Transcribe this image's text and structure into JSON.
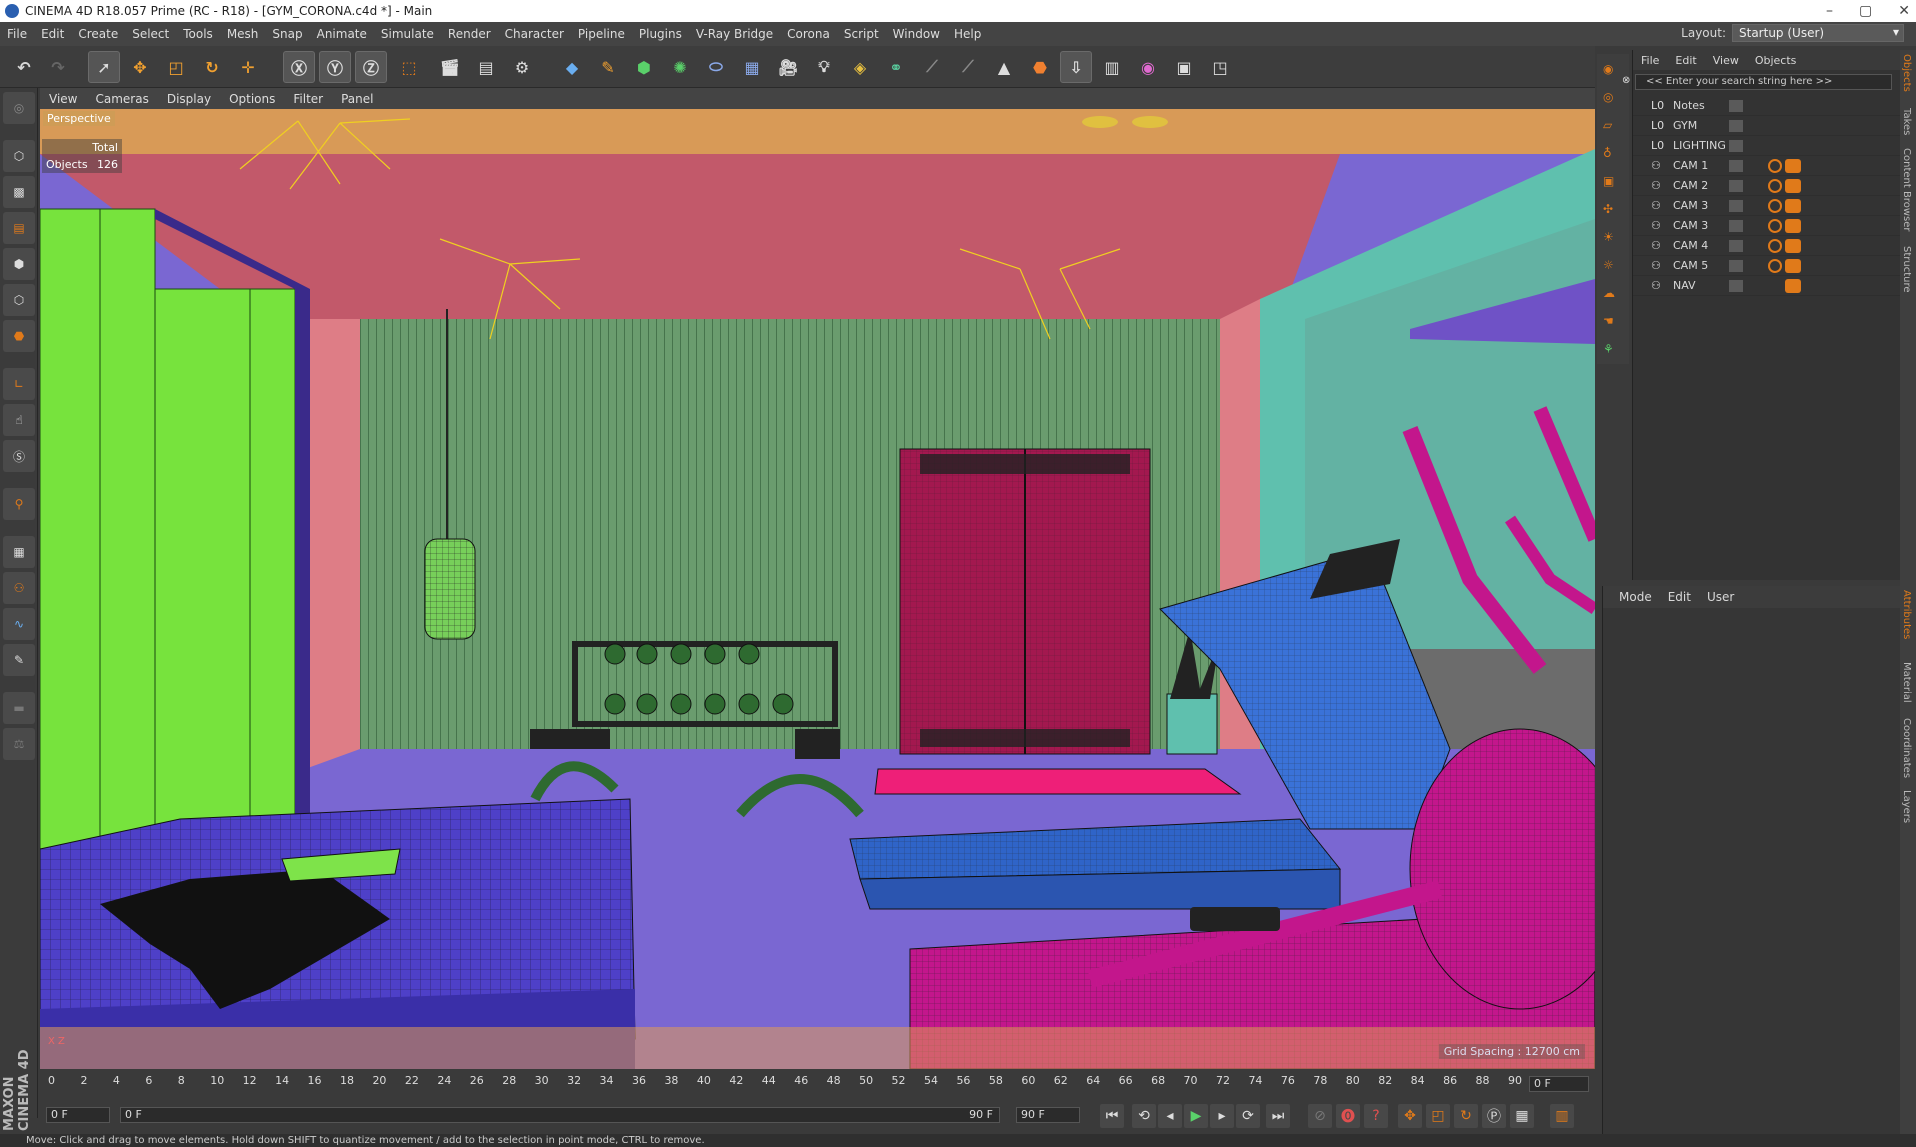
{
  "window": {
    "title": "CINEMA 4D R18.057 Prime (RC - R18) - [GYM_CORONA.c4d *] - Main",
    "controls": [
      "–",
      "▢",
      "✕"
    ]
  },
  "menu": [
    "File",
    "Edit",
    "Create",
    "Select",
    "Tools",
    "Mesh",
    "Snap",
    "Animate",
    "Simulate",
    "Render",
    "Character",
    "Pipeline",
    "Plugins",
    "V-Ray Bridge",
    "Corona",
    "Script",
    "Window",
    "Help"
  ],
  "layout": {
    "label": "Layout:",
    "value": "Startup (User)"
  },
  "viewport": {
    "menu": [
      "View",
      "Cameras",
      "Display",
      "Options",
      "Filter",
      "Panel"
    ],
    "mode": "Perspective",
    "stats": {
      "total_label": "Total",
      "objects_label": "Objects",
      "objects_value": "126"
    },
    "grid_spacing": "Grid Spacing : 12700 cm",
    "axis": "X  Z"
  },
  "object_manager": {
    "menu": [
      "File",
      "Edit",
      "View",
      "Objects"
    ],
    "search_placeholder": "<< Enter your search string here >>",
    "objects": [
      {
        "name": "Notes",
        "type": "layer",
        "tags": false
      },
      {
        "name": "GYM",
        "type": "layer",
        "tags": false
      },
      {
        "name": "LIGHTING",
        "type": "layer",
        "tags": false
      },
      {
        "name": "CAM 1",
        "type": "camera",
        "tags": true
      },
      {
        "name": "CAM 2",
        "type": "camera",
        "tags": true
      },
      {
        "name": "CAM 3",
        "type": "camera",
        "tags": true
      },
      {
        "name": "CAM 3",
        "type": "camera",
        "tags": true
      },
      {
        "name": "CAM 4",
        "type": "camera",
        "tags": true
      },
      {
        "name": "CAM 5",
        "type": "camera",
        "tags": true
      },
      {
        "name": "NAV",
        "type": "camera",
        "tags": "one"
      }
    ]
  },
  "attributes": {
    "menu": [
      "Mode",
      "Edit",
      "User"
    ]
  },
  "side_tabs": [
    "Objects",
    "Takes",
    "Content Browser",
    "Structure",
    "Attributes",
    "Material",
    "Coordinates",
    "Layers"
  ],
  "timeline": {
    "ticks": [
      "0",
      "2",
      "4",
      "6",
      "8",
      "10",
      "12",
      "14",
      "16",
      "18",
      "20",
      "22",
      "24",
      "26",
      "28",
      "30",
      "32",
      "34",
      "36",
      "38",
      "40",
      "42",
      "44",
      "46",
      "48",
      "50",
      "52",
      "54",
      "56",
      "58",
      "60",
      "62",
      "64",
      "66",
      "68",
      "70",
      "72",
      "74",
      "76",
      "78",
      "80",
      "82",
      "84",
      "86",
      "88",
      "90"
    ],
    "current_frame": "0 F",
    "start": "0 F",
    "min": "0 F",
    "max": "90 F",
    "end": "90 F"
  },
  "status": "Move: Click and drag to move elements. Hold down SHIFT to quantize movement / add to the selection in point mode, CTRL to remove.",
  "brand": "MAXON CINEMA 4D",
  "colors": {
    "accent": "#e07a1a",
    "viewport_bg": "#7a67d2"
  }
}
